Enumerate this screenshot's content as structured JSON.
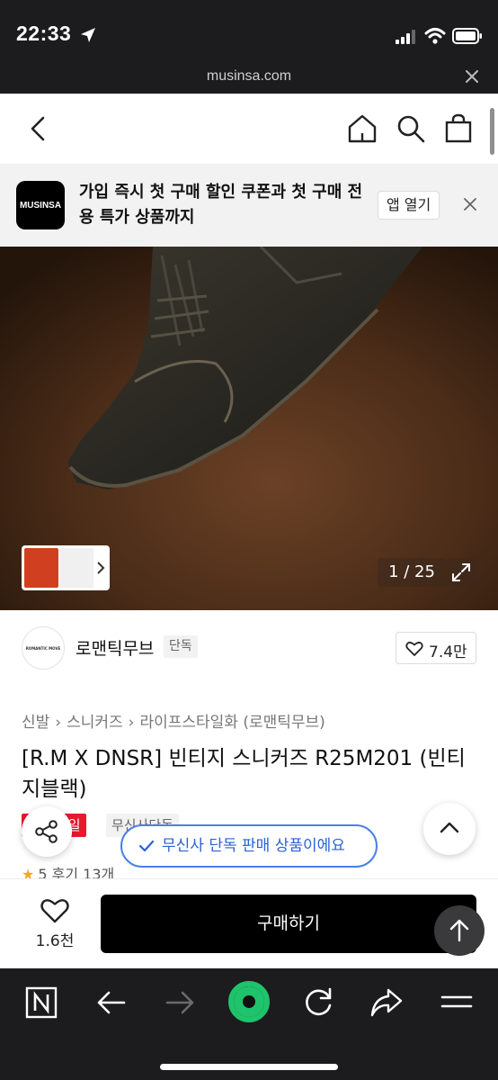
{
  "status_bar": {
    "time": "22:33"
  },
  "url_bar": {
    "url": "musinsa.com"
  },
  "banner": {
    "logo_text": "MUSINSA",
    "message": "가입 즉시 첫 구매 할인 쿠폰과 첫 구매 전용 특가 상품까지",
    "open_app_label": "앱 열기"
  },
  "gallery": {
    "counter": "1 / 25"
  },
  "brand": {
    "avatar_text": "ROMANTIC MOVE",
    "name": "로맨틱무브",
    "badge": "단독",
    "like_count": "7.4만"
  },
  "breadcrumb": [
    "신발",
    "스니커즈",
    "라이프스타일화 (로맨틱무브)"
  ],
  "product": {
    "title": "[R.M X DNSR] 빈티지 스니커즈 R25M201 (빈티지블랙)",
    "sale_badge": "세일",
    "exclusive_badge": "무신사단독",
    "rating_text": "5 후기 13개"
  },
  "toast": {
    "message": "무신사 단독 판매 상품이에요"
  },
  "purchase": {
    "wish_count": "1.6천",
    "buy_label": "구매하기"
  },
  "colors": {
    "accent_blue": "#2a62d6",
    "sale_red": "#e8192c",
    "star": "#f5a623",
    "toolbar_green": "#1ec36b"
  }
}
